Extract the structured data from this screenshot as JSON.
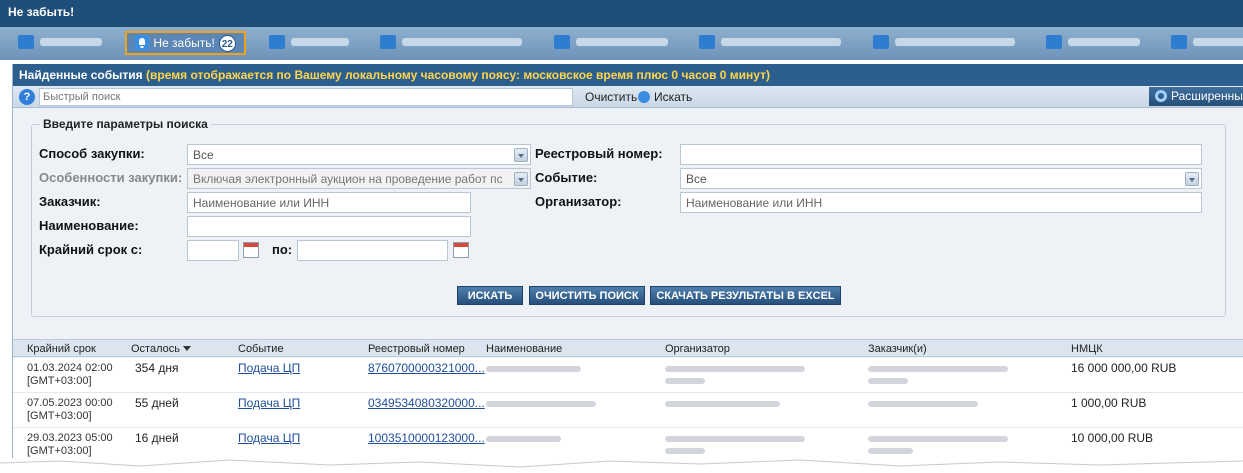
{
  "window": {
    "title": "Не забыть!"
  },
  "tabs": [
    {
      "label": "Не забыть!",
      "badge": "22",
      "active": true
    }
  ],
  "panel": {
    "title_main": "Найденные события",
    "title_note": "(время отображается по Вашему локальному часовому поясу: московское время плюс 0 часов 0 минут)"
  },
  "quick_search": {
    "help": "?",
    "placeholder": "Быстрый поиск",
    "clear_label": "Очистить",
    "search_label": "Искать",
    "advanced_label": "Расширенный поис"
  },
  "form": {
    "legend": "Введите параметры поиска",
    "method_label": "Способ закупки:",
    "method_value": "Все",
    "features_label": "Особенности закупки:",
    "features_value": "Включая электронный аукцион на проведение работ пс",
    "customer_label": "Заказчик:",
    "customer_placeholder": "Наименование или ИНН",
    "name_label": "Наименование:",
    "deadline_from_label": "Крайний срок с:",
    "deadline_to_label": "по:",
    "reg_number_label": "Реестровый номер:",
    "event_label": "Событие:",
    "event_value": "Все",
    "organizer_label": "Организатор:",
    "organizer_placeholder": "Наименование или ИНН"
  },
  "buttons": {
    "search": "ИСКАТЬ",
    "clear": "ОЧИСТИТЬ ПОИСК",
    "excel": "СКАЧАТЬ РЕЗУЛЬТАТЫ В EXCEL"
  },
  "table": {
    "columns": [
      "Крайний срок",
      "Осталось",
      "Событие",
      "Реестровый номер",
      "Наименование",
      "Организатор",
      "Заказчик(и)",
      "НМЦК"
    ],
    "rows": [
      {
        "deadline": "01.03.2024 02:00",
        "tz": "[GMT+03:00]",
        "left": "354 дня",
        "event": "Подача ЦП",
        "reg": "8760700000321000...",
        "nmck": "16 000 000,00 RUB"
      },
      {
        "deadline": "07.05.2023 00:00",
        "tz": "[GMT+03:00]",
        "left": "55 дней",
        "event": "Подача ЦП",
        "reg": "0349534080320000...",
        "nmck": "1 000,00 RUB"
      },
      {
        "deadline": "29.03.2023 05:00",
        "tz": "[GMT+03:00]",
        "left": "16 дней",
        "event": "Подача ЦП",
        "reg": "1003510000123000...",
        "nmck": "10 000,00 RUB"
      }
    ]
  },
  "colors": {
    "header": "#1f4e79",
    "panel_header": "#2d5f8e",
    "accent": "#f0a21a",
    "link": "#1f4e9a"
  }
}
